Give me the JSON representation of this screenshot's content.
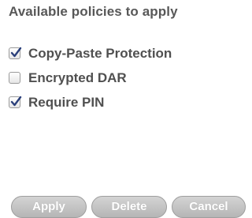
{
  "panel": {
    "heading": "Available policies to apply"
  },
  "policies": [
    {
      "label": "Copy-Paste Protection",
      "checked": true
    },
    {
      "label": "Encrypted DAR",
      "checked": false
    },
    {
      "label": "Require PIN",
      "checked": true
    }
  ],
  "buttons": {
    "apply_label": "Apply",
    "delete_label": "Delete",
    "cancel_label": "Cancel"
  },
  "colors": {
    "checkmark": "#2a3f7a",
    "button_text": "#ffffff",
    "heading_text": "#585858"
  }
}
